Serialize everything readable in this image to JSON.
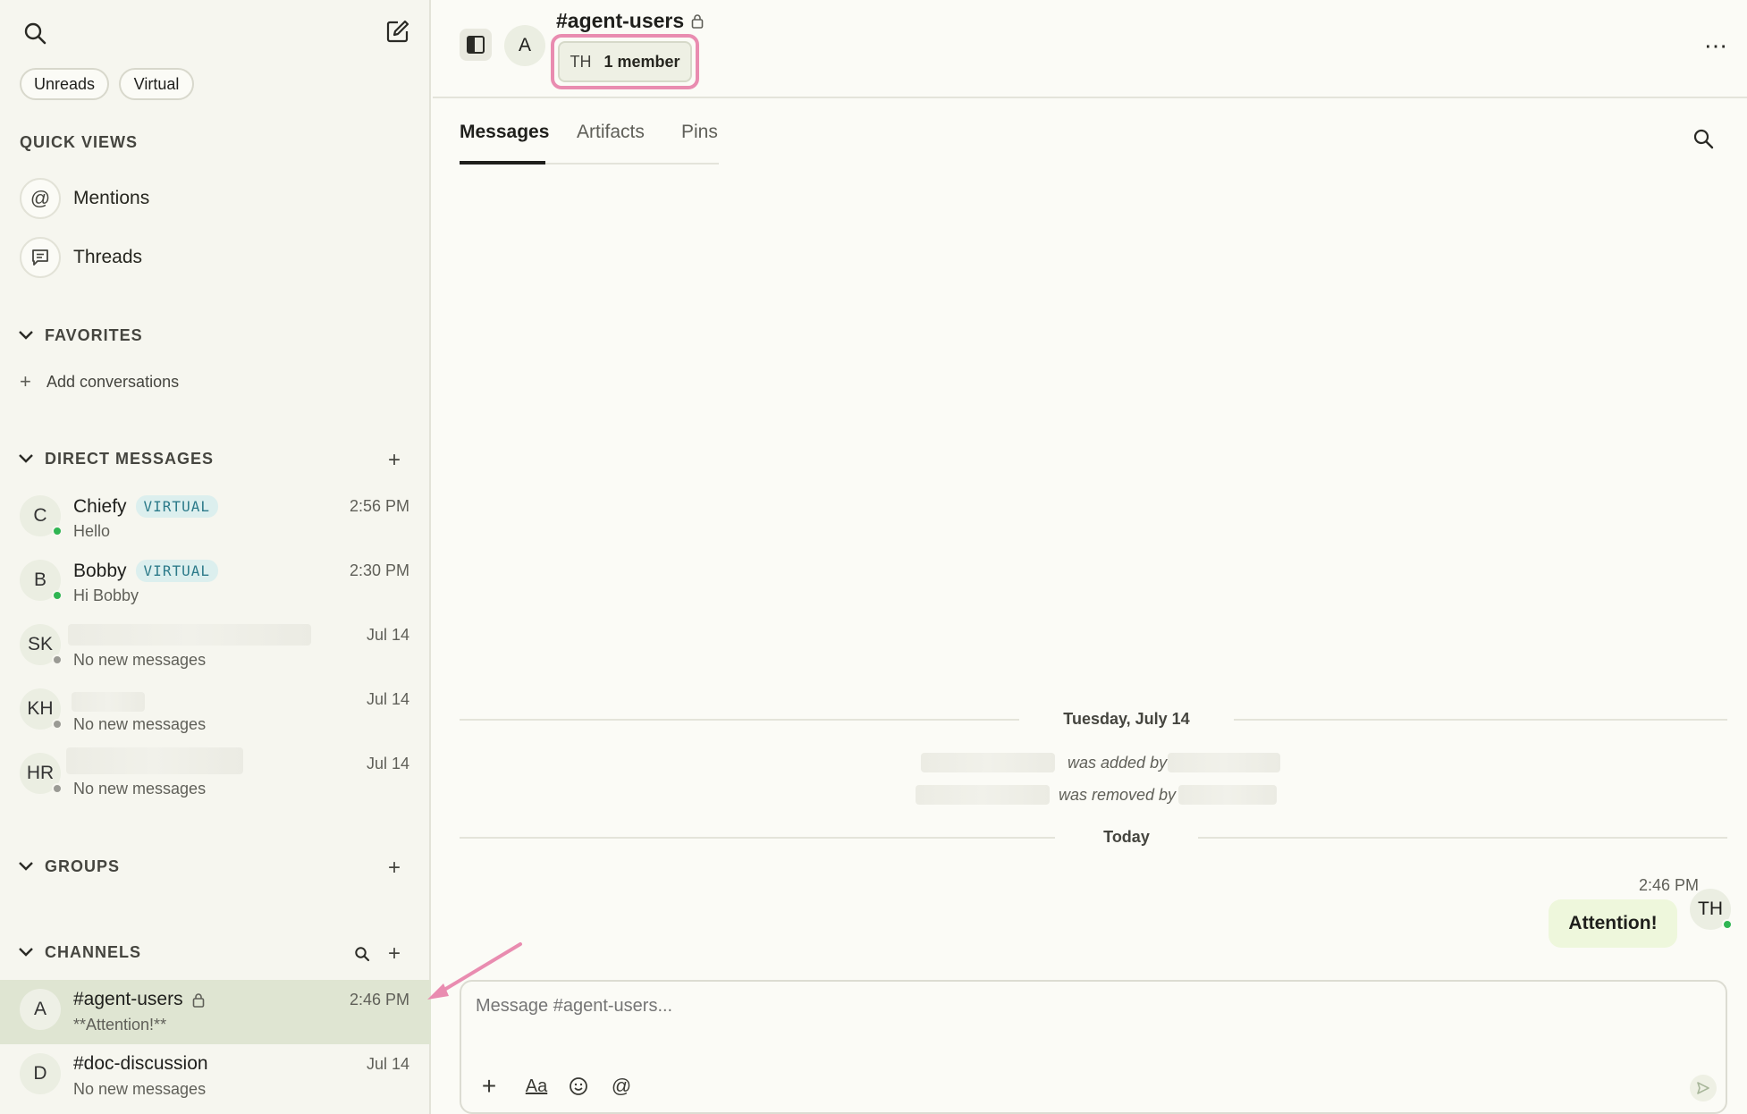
{
  "sidebar": {
    "filters": [
      "Unreads",
      "Virtual"
    ],
    "quick_views_title": "QUICK VIEWS",
    "quick_views": [
      {
        "label": "Mentions",
        "icon": "at-icon"
      },
      {
        "label": "Threads",
        "icon": "threads-icon"
      }
    ],
    "favorites_title": "FAVORITES",
    "add_conversations": "Add conversations",
    "dm_title": "DIRECT MESSAGES",
    "dms": [
      {
        "initials": "C",
        "name": "Chiefy",
        "badge": "VIRTUAL",
        "sub": "Hello",
        "time": "2:56 PM",
        "online": true
      },
      {
        "initials": "B",
        "name": "Bobby",
        "badge": "VIRTUAL",
        "sub": "Hi Bobby",
        "time": "2:30 PM",
        "online": true
      },
      {
        "initials": "SK",
        "name": "",
        "badge": "",
        "sub": "No new messages",
        "time": "Jul 14",
        "online": false
      },
      {
        "initials": "KH",
        "name": "",
        "badge": "",
        "sub": "No new messages",
        "time": "Jul 14",
        "online": false
      },
      {
        "initials": "HR",
        "name": "",
        "badge": "",
        "sub": "No new messages",
        "time": "Jul 14",
        "online": false
      }
    ],
    "groups_title": "GROUPS",
    "channels_title": "CHANNELS",
    "channels": [
      {
        "initials": "A",
        "name": "#agent-users",
        "sub": "**Attention!**",
        "time": "2:46 PM",
        "locked": true,
        "active": true
      },
      {
        "initials": "D",
        "name": "#doc-discussion",
        "sub": "No new messages",
        "time": "Jul 14",
        "locked": false,
        "active": false
      }
    ]
  },
  "header": {
    "channel_initial": "A",
    "channel_name": "#agent-users",
    "member_initials": "TH",
    "member_count": "1 member"
  },
  "tabs": [
    "Messages",
    "Artifacts",
    "Pins"
  ],
  "messages": {
    "date_divider": "Tuesday, July 14",
    "events": [
      "was added by",
      "was removed by"
    ],
    "today_divider": "Today",
    "last": {
      "time": "2:46 PM",
      "text": "Attention!",
      "sender_initials": "TH"
    }
  },
  "composer": {
    "placeholder": "Message #agent-users...",
    "format_label": "Aa"
  },
  "colors": {
    "accent_highlight": "#e98cb0",
    "active_row": "#dfe5d2",
    "online": "#2fb552",
    "bubble": "#eef7dc"
  }
}
